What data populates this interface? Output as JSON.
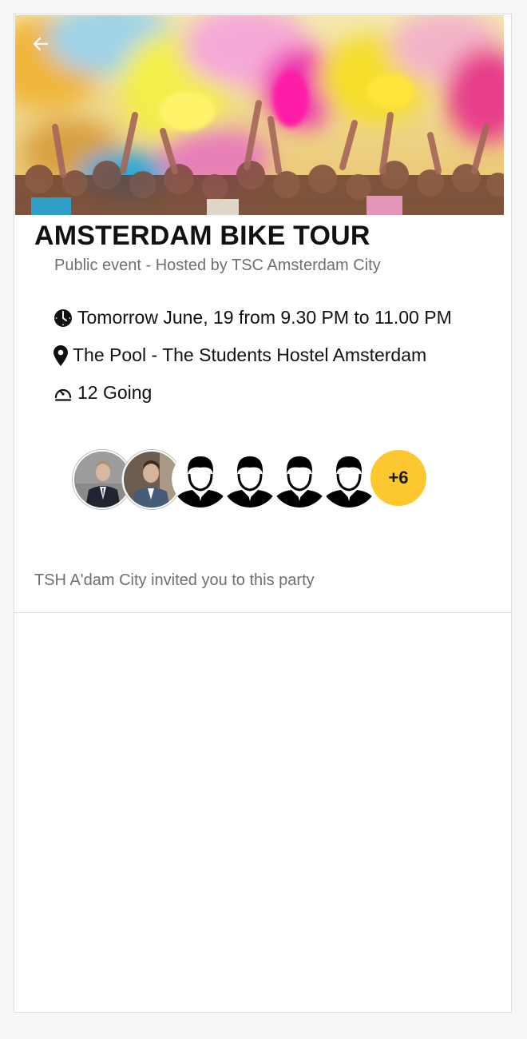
{
  "event": {
    "title": "AMSTERDAM BIKE TOUR",
    "subtitle": "Public event - Hosted by TSC Amsterdam City",
    "time": "Tomorrow June, 19 from 9.30 PM to 11.00 PM",
    "location": "The Pool - The Students Hostel Amsterdam",
    "going": "12 Going"
  },
  "attendees": {
    "more_label": "+6",
    "more_color": "#fdc82f"
  },
  "invite": {
    "text": "TSH A'dam City invited you to this party"
  },
  "icons": {
    "back": "arrow-left-icon",
    "time": "clock-icon",
    "location": "map-pin-icon",
    "going": "gauge-icon"
  }
}
